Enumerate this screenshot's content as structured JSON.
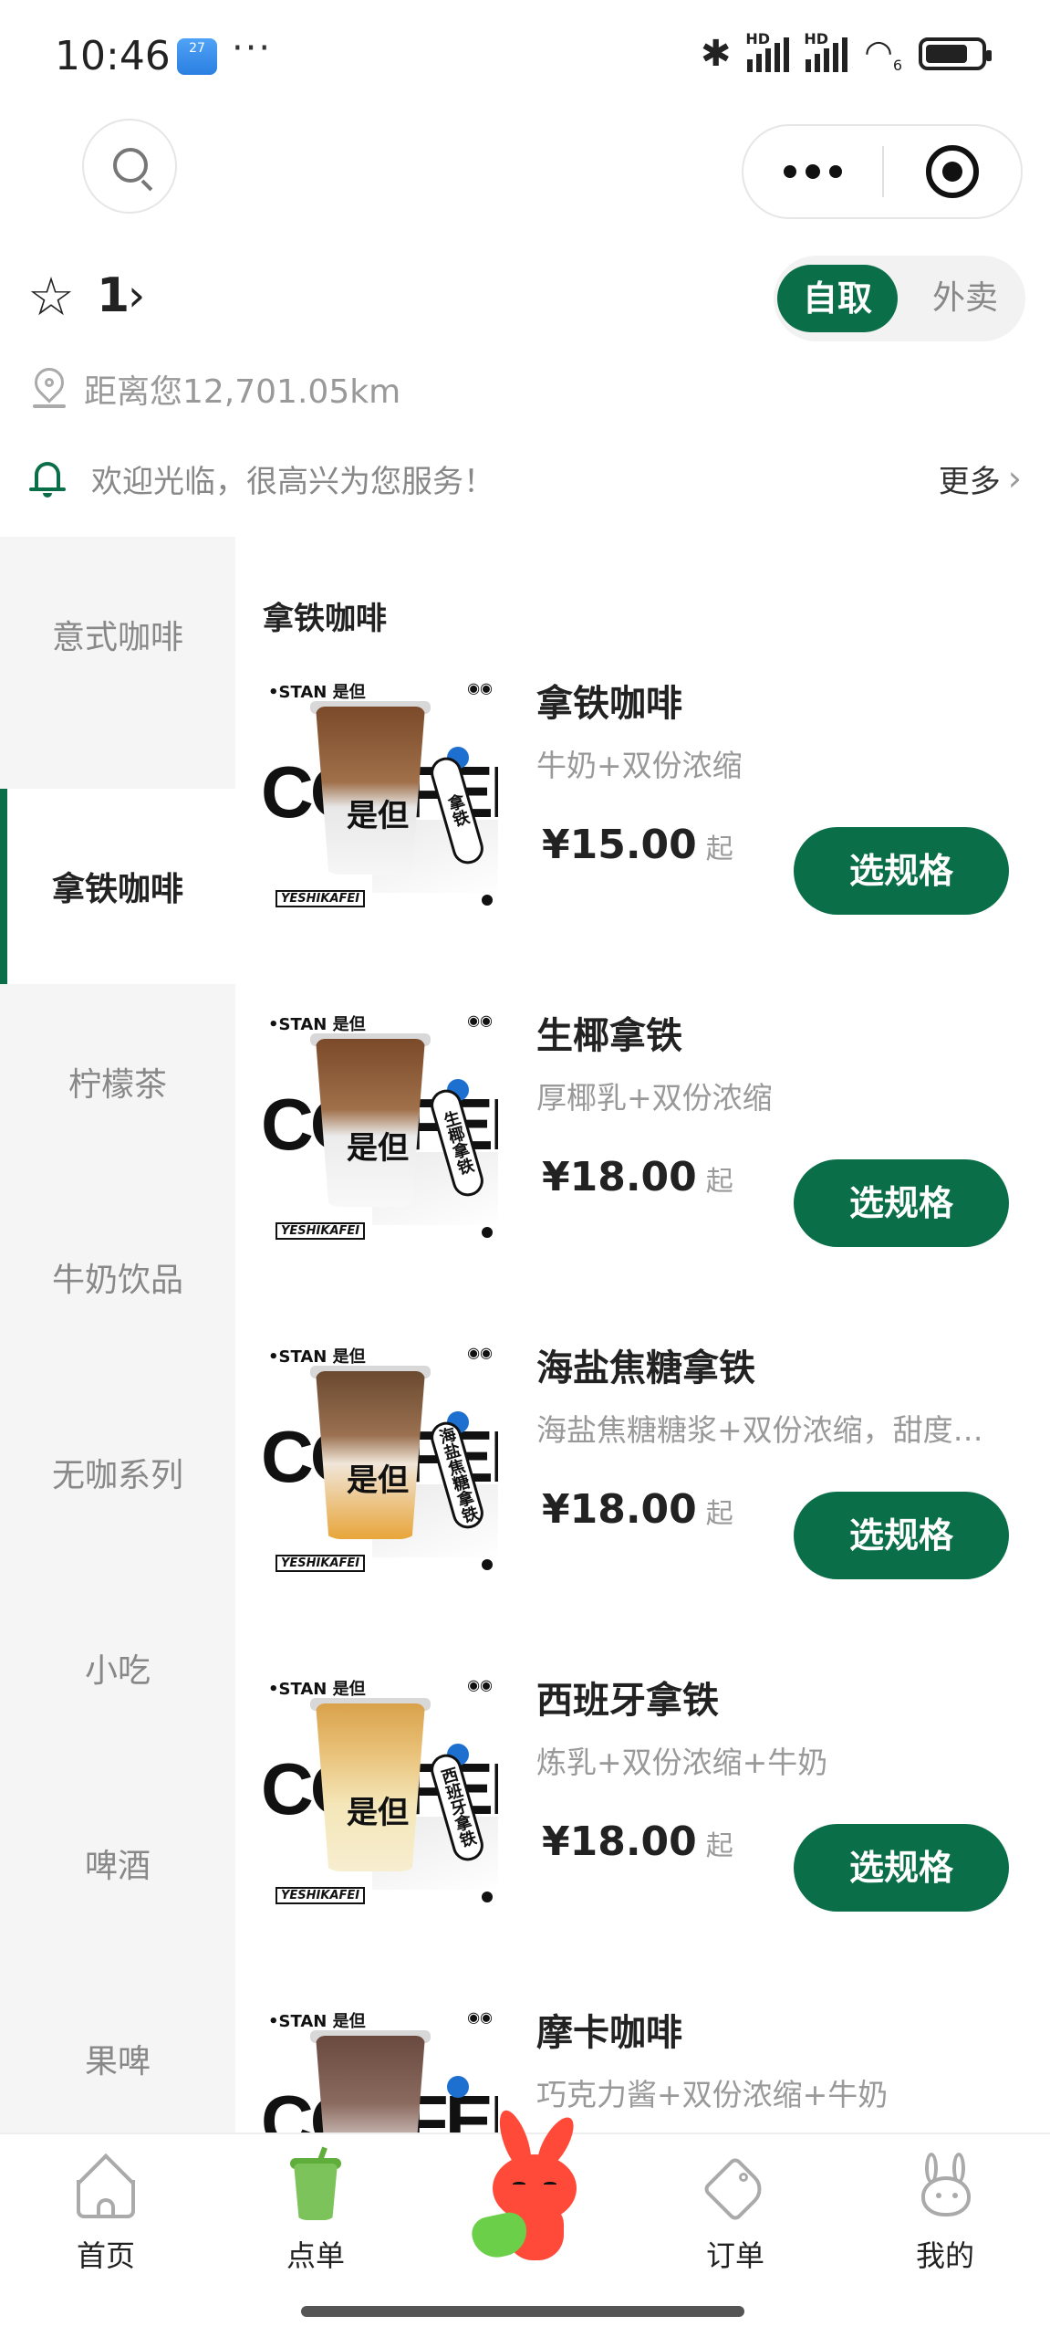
{
  "status_bar": {
    "time": "10:46",
    "app_badge": "27",
    "more": "···",
    "signal_label_1": "HD",
    "signal_label_2": "HD",
    "wifi_label": "6"
  },
  "store": {
    "number": "1",
    "distance": "距离您12,701.05km",
    "mode_pickup": "自取",
    "mode_delivery": "外卖",
    "notice": "欢迎光临，很高兴为您服务！",
    "notice_more": "更多"
  },
  "categories": [
    {
      "label": "意式咖啡",
      "active": false
    },
    {
      "label": "拿铁咖啡",
      "active": true
    },
    {
      "label": "柠檬茶",
      "active": false
    },
    {
      "label": "牛奶饮品",
      "active": false
    },
    {
      "label": "无咖系列",
      "active": false
    },
    {
      "label": "小吃",
      "active": false
    },
    {
      "label": "啤酒",
      "active": false
    },
    {
      "label": "果啤",
      "active": false
    }
  ],
  "section_title": "拿铁咖啡",
  "products": [
    {
      "name": "拿铁咖啡",
      "desc": "牛奶+双份浓缩",
      "price": "¥15.00",
      "from": "起",
      "button": "选规格",
      "tag": "拿铁",
      "cup_top": "#7a4a2a",
      "cup_bottom": "#e8e8e8"
    },
    {
      "name": "生椰拿铁",
      "desc": "厚椰乳+双份浓缩",
      "price": "¥18.00",
      "from": "起",
      "button": "选规格",
      "tag": "生椰拿铁",
      "cup_top": "#7a4a2a",
      "cup_bottom": "#ececec"
    },
    {
      "name": "海盐焦糖拿铁",
      "desc": "海盐焦糖糖浆+双份浓缩，甜度…",
      "price": "¥18.00",
      "from": "起",
      "button": "选规格",
      "tag": "海盐焦糖拿铁",
      "cup_top": "#6b4a30",
      "cup_bottom": "#e8a53a"
    },
    {
      "name": "西班牙拿铁",
      "desc": "炼乳+双份浓缩+牛奶",
      "price": "¥18.00",
      "from": "起",
      "button": "选规格",
      "tag": "西班牙拿铁",
      "cup_top": "#d9a24a",
      "cup_bottom": "#f4e6b8"
    },
    {
      "name": "摩卡咖啡",
      "desc": "巧克力酱+双份浓缩+牛奶",
      "price": "",
      "from": "",
      "button": "",
      "tag": "",
      "cup_top": "#6a4a3e",
      "cup_bottom": "#e6dcdc"
    }
  ],
  "thumb_text": {
    "brand": "•STAN 是但",
    "big_word": "COFFEE",
    "mark": "是但",
    "footer": "YESHIKAFEI"
  },
  "bottom_nav": [
    {
      "label": "首页",
      "icon": "home-icon"
    },
    {
      "label": "点单",
      "icon": "drink-cup-icon"
    },
    {
      "label": "",
      "icon": "mascot-icon"
    },
    {
      "label": "订单",
      "icon": "tag-icon"
    },
    {
      "label": "我的",
      "icon": "rabbit-icon"
    }
  ],
  "colors": {
    "accent": "#0a6e48",
    "sidebar_bg": "#f5f5f5",
    "muted_text": "#999999"
  }
}
